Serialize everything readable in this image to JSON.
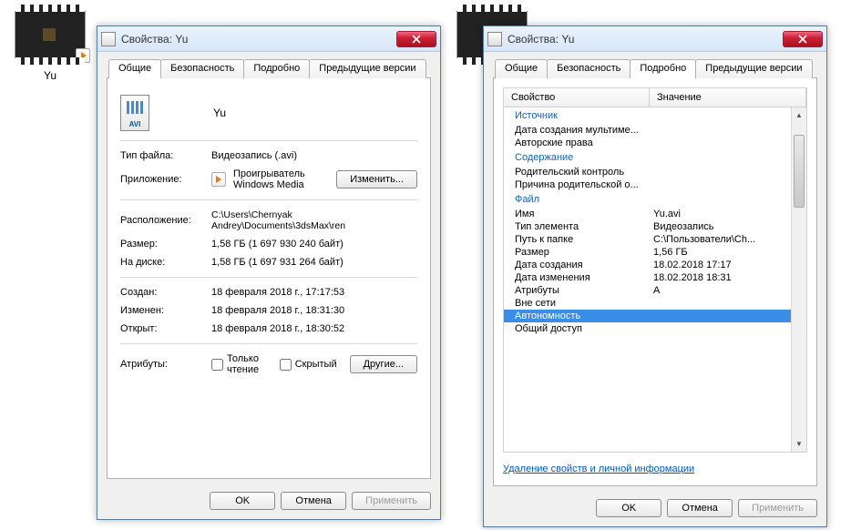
{
  "desktop": {
    "file1_label": "Yu",
    "file2_label": ""
  },
  "dialog1": {
    "title": "Свойства: Yu",
    "tabs": [
      "Общие",
      "Безопасность",
      "Подробно",
      "Предыдущие версии"
    ],
    "active_tab": 0,
    "file_icon_text": "AVI",
    "name": "Yu",
    "rows": {
      "type_label": "Тип файла:",
      "type_value": "Видеозапись (.avi)",
      "app_label": "Приложение:",
      "app_value": "Проигрыватель Windows Media",
      "change_btn": "Изменить...",
      "location_label": "Расположение:",
      "location_value": "C:\\Users\\Chernyak Andrey\\Documents\\3dsMax\\ren",
      "size_label": "Размер:",
      "size_value": "1,58 ГБ (1 697 930 240 байт)",
      "disk_label": "На диске:",
      "disk_value": "1,58 ГБ (1 697 931 264 байт)",
      "created_label": "Создан:",
      "created_value": "18 февраля 2018 г., 17:17:53",
      "modified_label": "Изменен:",
      "modified_value": "18 февраля 2018 г., 18:31:30",
      "opened_label": "Открыт:",
      "opened_value": "18 февраля 2018 г., 18:30:52",
      "attrs_label": "Атрибуты:",
      "readonly_label": "Только чтение",
      "hidden_label": "Скрытый",
      "other_btn": "Другие..."
    },
    "footer": {
      "ok": "OK",
      "cancel": "Отмена",
      "apply": "Применить"
    }
  },
  "dialog2": {
    "title": "Свойства: Yu",
    "tabs": [
      "Общие",
      "Безопасность",
      "Подробно",
      "Предыдущие версии"
    ],
    "active_tab": 2,
    "header_prop": "Свойство",
    "header_val": "Значение",
    "groups": [
      {
        "label": "Источник",
        "rows": [
          {
            "name": "Дата создания мультиме...",
            "value": ""
          },
          {
            "name": "Авторские права",
            "value": ""
          }
        ]
      },
      {
        "label": "Содержание",
        "rows": [
          {
            "name": "Родительский контроль",
            "value": ""
          },
          {
            "name": "Причина родительской о...",
            "value": ""
          }
        ]
      },
      {
        "label": "Файл",
        "rows": [
          {
            "name": "Имя",
            "value": "Yu.avi"
          },
          {
            "name": "Тип элемента",
            "value": "Видеозапись"
          },
          {
            "name": "Путь к папке",
            "value": "C:\\Пользователи\\Ch..."
          },
          {
            "name": "Размер",
            "value": "1,56 ГБ"
          },
          {
            "name": "Дата создания",
            "value": "18.02.2018 17:17"
          },
          {
            "name": "Дата изменения",
            "value": "18.02.2018 18:31"
          },
          {
            "name": "Атрибуты",
            "value": "A"
          },
          {
            "name": "Вне сети",
            "value": ""
          },
          {
            "name": "Автономность",
            "value": "",
            "selected": true
          },
          {
            "name": "Общий доступ",
            "value": ""
          }
        ]
      }
    ],
    "remove_link": "Удаление свойств и личной информации",
    "footer": {
      "ok": "OK",
      "cancel": "Отмена",
      "apply": "Применить"
    }
  }
}
